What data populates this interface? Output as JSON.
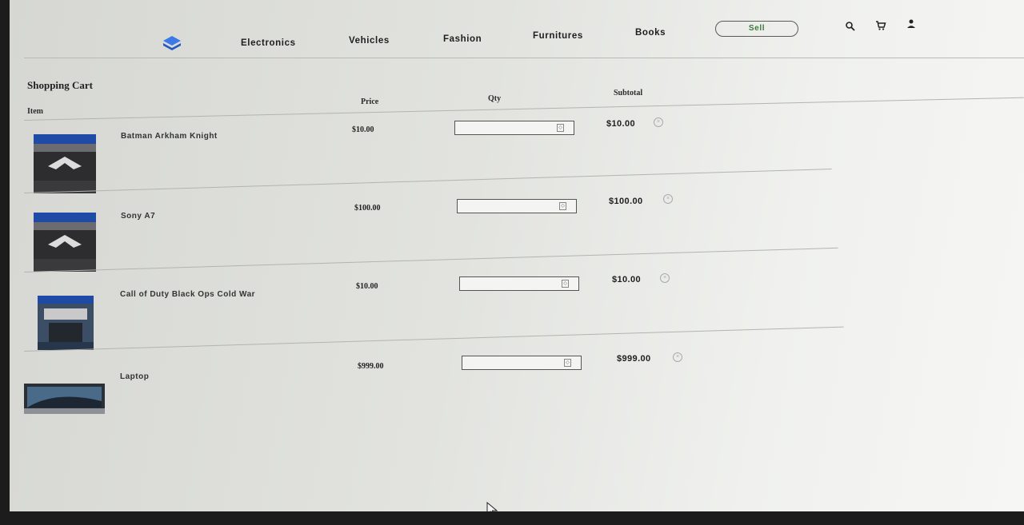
{
  "nav": {
    "links": [
      "Electronics",
      "Vehicles",
      "Fashion",
      "Furnitures",
      "Books"
    ],
    "sell_label": "Sell",
    "icons": [
      "search-icon",
      "cart-icon",
      "user-icon"
    ]
  },
  "cart": {
    "title": "Shopping Cart",
    "headers": {
      "item": "Item",
      "price": "Price",
      "qty": "Qty",
      "subtotal": "Subtotal"
    },
    "items": [
      {
        "name": "Batman Arkham Knight",
        "price": "$10.00",
        "qty": "",
        "subtotal": "$10.00"
      },
      {
        "name": "Sony A7",
        "price": "$100.00",
        "qty": "",
        "subtotal": "$100.00"
      },
      {
        "name": "Call of Duty Black Ops Cold War",
        "price": "$10.00",
        "qty": "",
        "subtotal": "$10.00"
      },
      {
        "name": "Laptop",
        "price": "$999.00",
        "qty": "",
        "subtotal": "$999.00"
      }
    ]
  },
  "colors": {
    "brand": "#2f6bd8",
    "sell_text": "#3a7a3a"
  }
}
